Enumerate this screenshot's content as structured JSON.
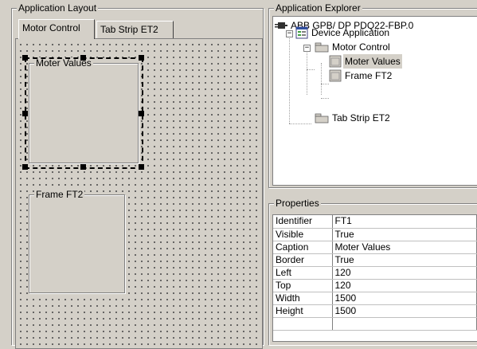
{
  "layout": {
    "title": "Application Layout",
    "tabs": [
      {
        "label": "Motor Control",
        "active": true
      },
      {
        "label": "Tab Strip ET2",
        "active": false
      }
    ],
    "frames": [
      {
        "title": "Moter Values",
        "selected": true
      },
      {
        "title": "Frame FT2",
        "selected": false
      }
    ]
  },
  "explorer": {
    "title": "Application Explorer",
    "nodes": [
      {
        "label": "ABB GPB/ DP PDQ22-FBP.0",
        "icon": "plug-icon"
      },
      {
        "label": "Device Application",
        "icon": "application-icon",
        "expander": "−"
      },
      {
        "label": "Motor Control",
        "icon": "folder-tab-icon",
        "expander": "−"
      },
      {
        "label": "Moter Values",
        "icon": "frame-icon",
        "selected": true
      },
      {
        "label": "Frame FT2",
        "icon": "frame-icon"
      },
      {
        "label": "Tab Strip ET2",
        "icon": "folder-tab-icon"
      }
    ]
  },
  "properties": {
    "title": "Properties",
    "rows": [
      {
        "key": "Identifier",
        "value": "FT1"
      },
      {
        "key": "Visible",
        "value": "True"
      },
      {
        "key": "Caption",
        "value": "Moter Values"
      },
      {
        "key": "Border",
        "value": "True"
      },
      {
        "key": "Left",
        "value": "120"
      },
      {
        "key": "Top",
        "value": "120"
      },
      {
        "key": "Width",
        "value": "1500"
      },
      {
        "key": "Height",
        "value": "1500"
      }
    ]
  },
  "colors": {
    "background": "#d4d0c8",
    "tree_background": "#ffffff",
    "selection_handle": "#000000"
  }
}
